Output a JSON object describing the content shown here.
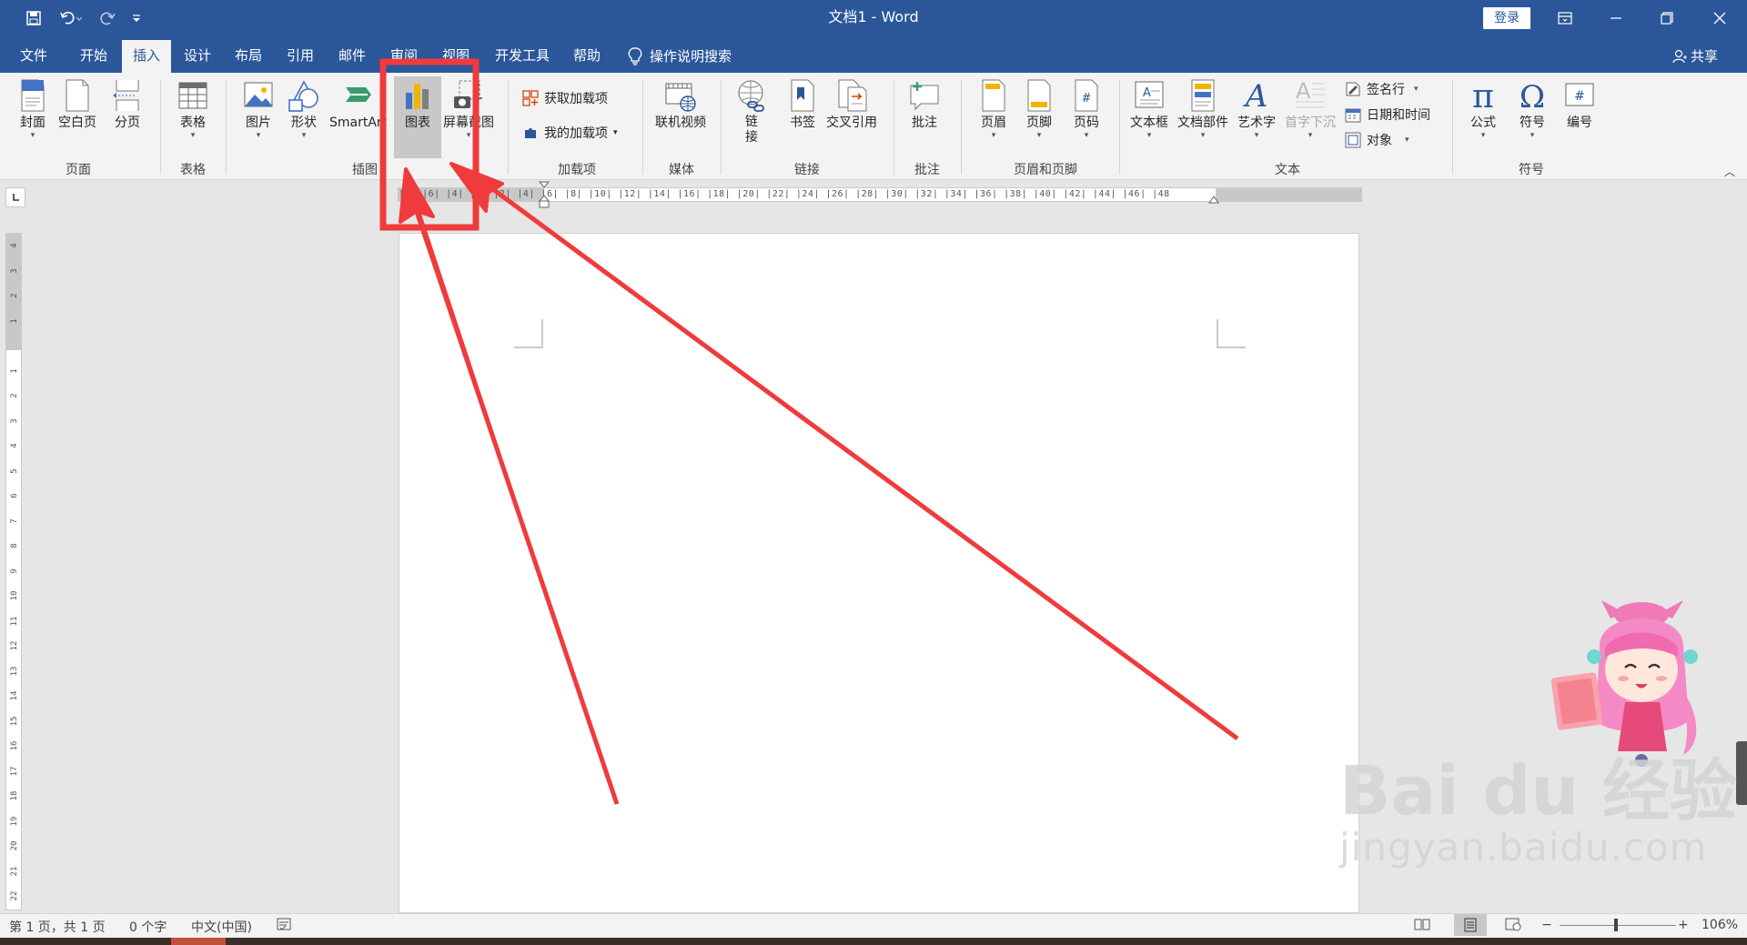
{
  "titlebar": {
    "title": "文档1  -  Word",
    "login": "登录"
  },
  "tabs": [
    "文件",
    "开始",
    "插入",
    "设计",
    "布局",
    "引用",
    "邮件",
    "审阅",
    "视图",
    "开发工具",
    "帮助"
  ],
  "active_tab": "插入",
  "tell_me": "操作说明搜索",
  "share": "共享",
  "ribbon": {
    "pages": {
      "cover": "封面",
      "blank": "空白页",
      "break": "分页",
      "group": "页面"
    },
    "tables": {
      "table": "表格",
      "group": "表格"
    },
    "illustrations": {
      "pictures": "图片",
      "shapes": "形状",
      "smartart": "SmartArt",
      "chart": "图表",
      "screenshot": "屏幕截图",
      "group": "插图"
    },
    "addins": {
      "get": "获取加载项",
      "my": "我的加载项",
      "group": "加载项"
    },
    "media": {
      "online_video": "联机视频",
      "group": "媒体"
    },
    "links": {
      "link": "链接",
      "bookmark": "书签",
      "crossref": "交叉引用",
      "group": "链接"
    },
    "comments": {
      "comment": "批注",
      "group": "批注"
    },
    "header_footer": {
      "header": "页眉",
      "footer": "页脚",
      "page_number": "页码",
      "group": "页眉和页脚"
    },
    "text": {
      "textbox": "文本框",
      "quickparts": "文档部件",
      "wordart": "艺术字",
      "dropcap": "首字下沉",
      "signature": "签名行",
      "datetime": "日期和时间",
      "object": "对象",
      "group": "文本"
    },
    "symbols": {
      "equation": "公式",
      "symbol": "符号",
      "numbering": "编号",
      "group": "符号"
    }
  },
  "ruler": {
    "h_ticks": "|8|  |6|  |4|  |2|     |2|  |4|  |6|  |8|  |10|  |12|  |14|  |16|  |18|  |20|  |22|  |24|  |26|  |28|  |30|  |32|  |34|  |36|  |38|  |40|  |42|  |44|  |46|  |48",
    "v_ticks": [
      "4",
      "3",
      "2",
      "1",
      "",
      "1",
      "2",
      "3",
      "4",
      "5",
      "6",
      "7",
      "8",
      "9",
      "10",
      "11",
      "12",
      "13",
      "14",
      "15",
      "16",
      "17",
      "18",
      "19",
      "20",
      "21",
      "22"
    ]
  },
  "status": {
    "page": "第 1 页，共 1 页",
    "words": "0 个字",
    "language": "中文(中国)",
    "zoom": "106%",
    "zoom_minus": "−",
    "zoom_plus": "+"
  },
  "watermark": {
    "big": "Bai du 经验",
    "small": "jingyan.baidu.com"
  },
  "colors": {
    "brand": "#2b579a",
    "annotation": "#ef3b3b",
    "ribbon": "#f3f3f3"
  }
}
